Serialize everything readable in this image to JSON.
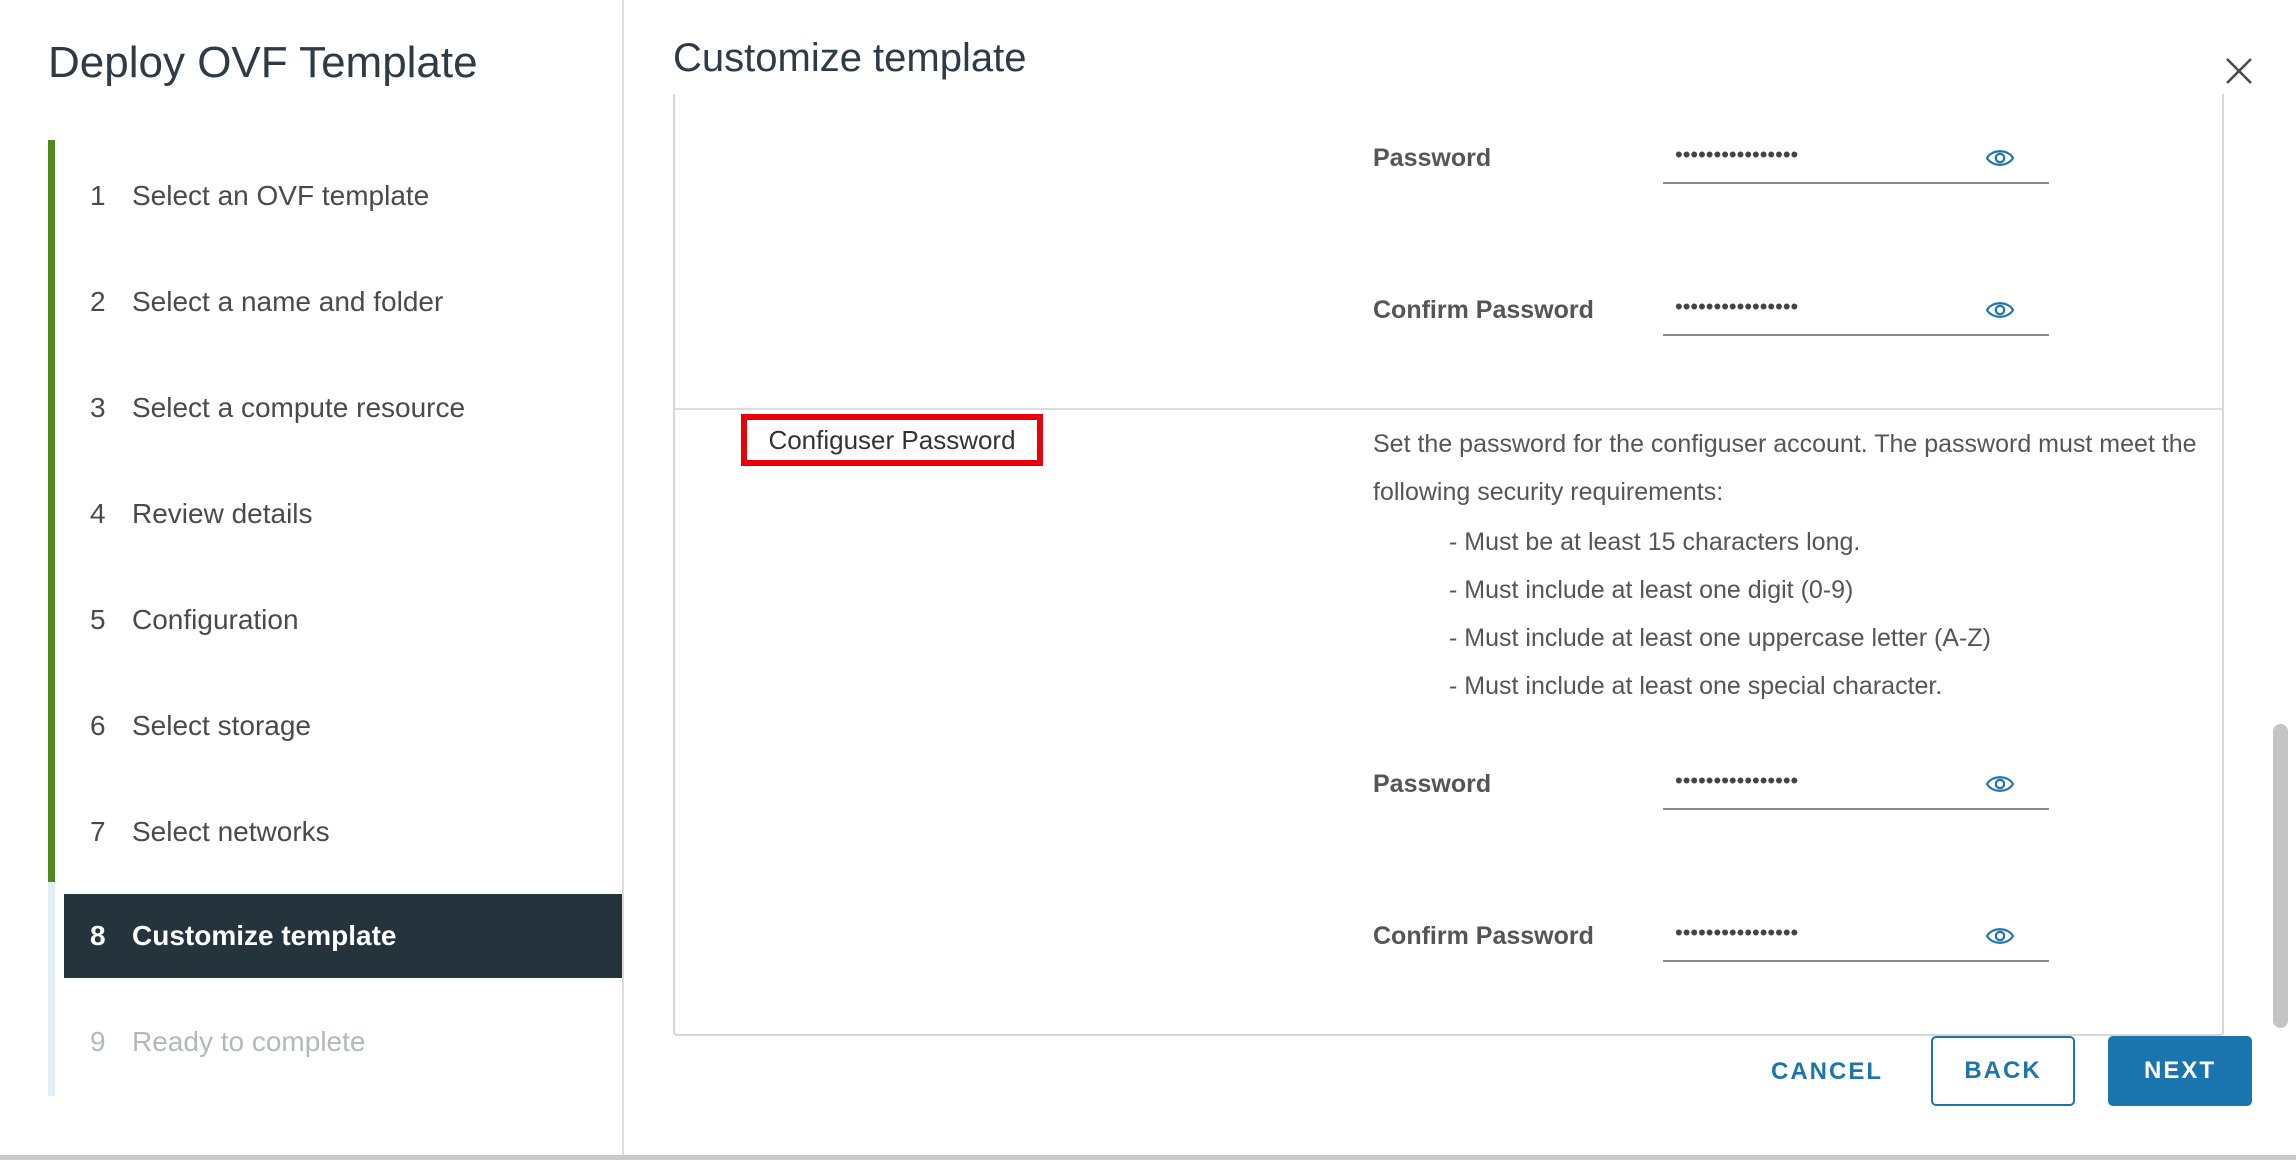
{
  "wizard": {
    "title": "Deploy OVF Template",
    "steps": [
      {
        "num": "1",
        "label": "Select an OVF template"
      },
      {
        "num": "2",
        "label": "Select a name and folder"
      },
      {
        "num": "3",
        "label": "Select a compute resource"
      },
      {
        "num": "4",
        "label": "Review details"
      },
      {
        "num": "5",
        "label": "Configuration"
      },
      {
        "num": "6",
        "label": "Select storage"
      },
      {
        "num": "7",
        "label": "Select networks"
      },
      {
        "num": "8",
        "label": "Customize template"
      },
      {
        "num": "9",
        "label": "Ready to complete"
      }
    ],
    "active_step": 8
  },
  "content": {
    "title": "Customize template",
    "upper": {
      "password_label": "Password",
      "password_value": "••••••••••••••••",
      "confirm_label": "Confirm Password",
      "confirm_value": "••••••••••••••••"
    },
    "configuser": {
      "name": "Configuser Password",
      "description": "Set the password for the configuser account. The password must meet the following security requirements:",
      "requirements": [
        "- Must be at least 15 characters long.",
        "- Must include at least one digit (0-9)",
        "- Must include at least one uppercase letter (A-Z)",
        "- Must include at least one special character."
      ],
      "password_label": "Password",
      "password_value": "••••••••••••••••",
      "confirm_label": "Confirm Password",
      "confirm_value": "••••••••••••••••"
    }
  },
  "footer": {
    "cancel": "CANCEL",
    "back": "BACK",
    "next": "NEXT"
  },
  "colors": {
    "accent": "#1a74ad",
    "completed_step": "#4d8a1e",
    "active_step_bg": "#25333d",
    "highlight": "#e8000a"
  },
  "icons": {
    "close": "close-icon",
    "reveal": "eye-icon"
  }
}
